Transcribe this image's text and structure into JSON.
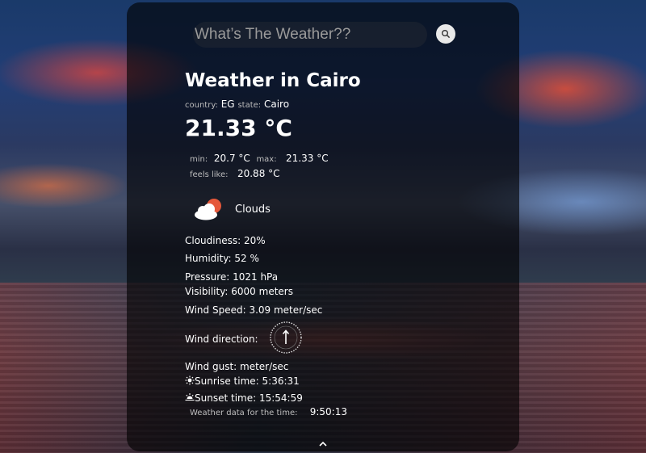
{
  "search": {
    "placeholder": "What’s The Weather??"
  },
  "weather": {
    "title": "Weather in Cairo",
    "country_label": "country:",
    "country": "EG",
    "state_label": "state:",
    "state": "Cairo",
    "temperature": "21.33 °C",
    "min_label": "min:",
    "min": "20.7 °C",
    "max_label": "max:",
    "max": "21.33 °C",
    "feels_label": "feels like:",
    "feels": "20.88 °C",
    "condition_icon": "cloud-sun-icon",
    "condition": "Clouds",
    "cloudiness": "Cloudiness: 20%",
    "humidity": "Humidity: 52 %",
    "pressure": "Pressure: 1021 hPa",
    "visibility": "Visibility: 6000 meters",
    "wind_speed": "Wind Speed: 3.09 meter/sec",
    "wind_direction_label": "Wind direction:",
    "wind_gust": "Wind gust: meter/sec",
    "sunrise": "Sunrise time: 5:36:31",
    "sunset": "Sunset time: 15:54:59",
    "data_time_label": "Weather data for the time:",
    "data_time": "9:50:13"
  },
  "colors": {
    "card": "#000000",
    "sun": "#e5583a",
    "cloud": "#ffffff"
  },
  "icons": {
    "search": "search-icon",
    "scroll": "chevron-up-icon",
    "compass": "compass-icon"
  }
}
